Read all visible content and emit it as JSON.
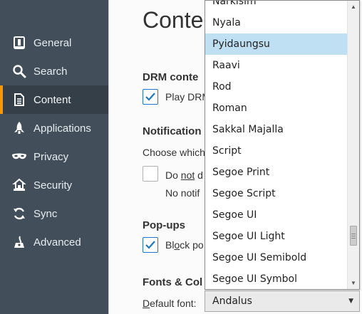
{
  "sidebar": {
    "items": [
      {
        "label": "General",
        "icon": "general-icon"
      },
      {
        "label": "Search",
        "icon": "search-icon"
      },
      {
        "label": "Content",
        "icon": "content-icon",
        "active": true
      },
      {
        "label": "Applications",
        "icon": "applications-icon"
      },
      {
        "label": "Privacy",
        "icon": "privacy-mask-icon"
      },
      {
        "label": "Security",
        "icon": "security-icon"
      },
      {
        "label": "Sync",
        "icon": "sync-icon"
      },
      {
        "label": "Advanced",
        "icon": "advanced-icon"
      }
    ]
  },
  "main": {
    "title": "Conten",
    "drm": {
      "heading": "DRM conte",
      "checkbox_label": "Play DRM",
      "checked": true
    },
    "notifications": {
      "heading": "Notification",
      "description": "Choose which",
      "dnd_pre": "Do ",
      "dnd_underlined": "not",
      "dnd_post": " d",
      "sub": "No notif"
    },
    "popups": {
      "heading": "Pop-ups",
      "checkbox_label_pre": "Bl",
      "checkbox_label_underlined": "o",
      "checkbox_label_post": "ck po",
      "checked": true
    },
    "fonts": {
      "heading": "Fonts & Col",
      "default_font_label_underlined": "D",
      "default_font_label_rest": "efault font:"
    }
  },
  "font_dropdown": {
    "selected": "Andalus",
    "highlighted": "Pyidaungsu",
    "options": [
      "Narkisim",
      "Nyala",
      "Pyidaungsu",
      "Raavi",
      "Rod",
      "Roman",
      "Sakkal Majalla",
      "Script",
      "Segoe Print",
      "Segoe Script",
      "Segoe UI",
      "Segoe UI Light",
      "Segoe UI Semibold",
      "Segoe UI Symbol"
    ]
  },
  "colors": {
    "accent": "#ff9500",
    "sidebar_bg": "#424f5a",
    "highlight": "#bfe0f3",
    "check": "#1d78c9"
  }
}
